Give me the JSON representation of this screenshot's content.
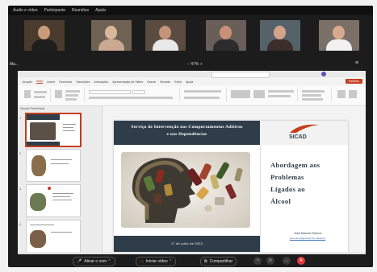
{
  "zoom_menu": [
    "Áudio e vídeo",
    "Participante",
    "Reuniões",
    "Ajuda"
  ],
  "share_bar": {
    "left_label": "Ma...",
    "zoom_level": "−  47%  +",
    "right_icon": "≡"
  },
  "ppt": {
    "tabs": [
      "Arquivo",
      "Base",
      "Inserir",
      "Desenhar",
      "Transições",
      "Animações",
      "Apresentação de Slides",
      "Gravar",
      "Revisão",
      "Exibir",
      "Ajuda"
    ],
    "share_label": "Partilhar",
    "thumb_header": "Secção Predefinida",
    "thumb_numbers": [
      "1",
      "2",
      "3",
      "4"
    ]
  },
  "slide": {
    "header_line1": "Serviço de Intervenção nos Comportamentos Aditivos",
    "header_line2": "e nas Dependências",
    "logo_text": "SICAD",
    "title_lines": [
      "Abordagem aos",
      "Problemas",
      "Ligados ao",
      "Álcool"
    ],
    "date": "17 de julho de 2023",
    "author": "José Manuel Ramos",
    "email": "jose.ramos@sicad.min-saude.pt"
  },
  "toolbar": {
    "audio_label": "Ativar o som",
    "video_label": "Iniciar vídeo",
    "share_label": "Compartilhar"
  },
  "colors": {
    "navy": "#2f3d4a",
    "accent": "#c43e1c",
    "leave": "#e03a3a"
  }
}
